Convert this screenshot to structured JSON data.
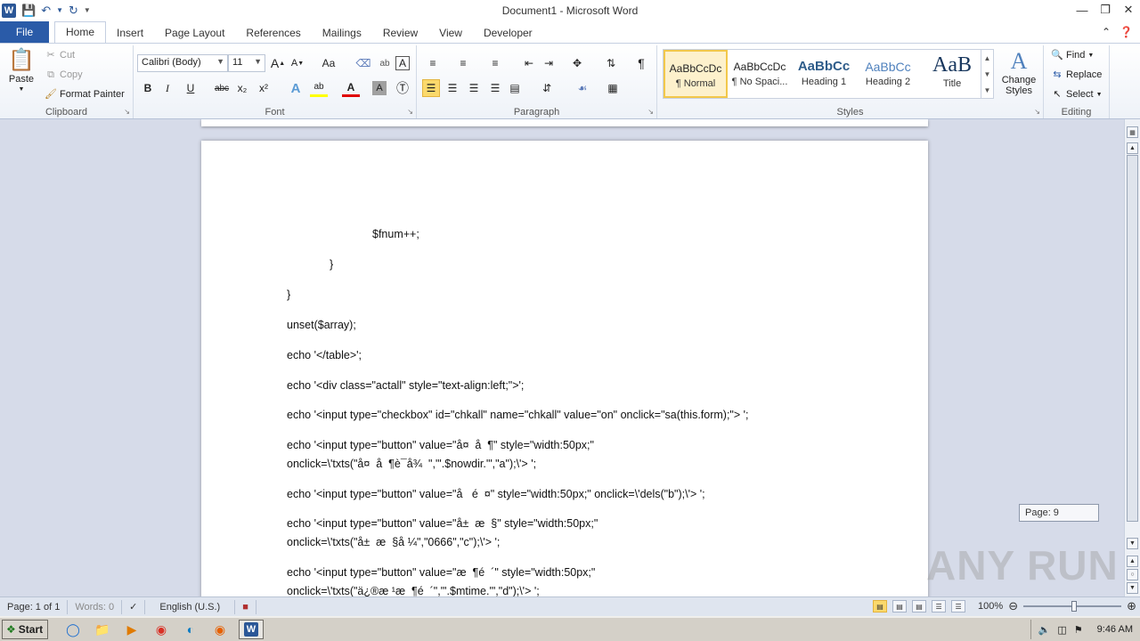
{
  "window": {
    "title": "Document1 - Microsoft Word",
    "controls": [
      "minimize",
      "restore",
      "close"
    ]
  },
  "qat": {
    "app_icon": "W",
    "save_icon": "save-icon",
    "undo_icon": "undo-icon",
    "redo_icon": "redo-icon"
  },
  "tabs": [
    {
      "label": "File"
    },
    {
      "label": "Home"
    },
    {
      "label": "Insert"
    },
    {
      "label": "Page Layout"
    },
    {
      "label": "References"
    },
    {
      "label": "Mailings"
    },
    {
      "label": "Review"
    },
    {
      "label": "View"
    },
    {
      "label": "Developer"
    }
  ],
  "active_tab": "Home",
  "ribbon": {
    "clipboard": {
      "label": "Clipboard",
      "paste": "Paste",
      "cut": "Cut",
      "copy": "Copy",
      "format_painter": "Format Painter"
    },
    "font": {
      "label": "Font",
      "font_name": "Calibri (Body)",
      "font_size": "11",
      "bold": "B",
      "italic": "I",
      "underline": "U",
      "strike": "abc",
      "subscript": "x₂",
      "superscript": "x²",
      "change_case": "Aa",
      "grow": "A",
      "shrink": "A"
    },
    "paragraph": {
      "label": "Paragraph",
      "pilcrow": "¶"
    },
    "styles": {
      "label": "Styles",
      "items": [
        {
          "preview": "AaBbCcDc",
          "name": "¶ Normal"
        },
        {
          "preview": "AaBbCcDc",
          "name": "¶ No Spaci..."
        },
        {
          "preview": "AaBbCc",
          "name": "Heading 1"
        },
        {
          "preview": "AaBbCc",
          "name": "Heading 2"
        },
        {
          "preview": "AaB",
          "name": "Title"
        }
      ],
      "change_styles": "Change Styles"
    },
    "editing": {
      "label": "Editing",
      "find": "Find",
      "replace": "Replace",
      "select": "Select"
    }
  },
  "document": {
    "lines": [
      "$fnum++;",
      "}",
      "}",
      "unset($array);",
      "echo '</table>';",
      "echo '<div class=\"actall\" style=\"text-align:left;\">';",
      "echo '<input type=\"checkbox\" id=\"chkall\" name=\"chkall\" value=\"on\" onclick=\"sa(this.form);\"> ';",
      "echo '<input type=\"button\" value=\"å¤  å  ¶\" style=\"width:50px;\"",
      "onclick=\\'txts(\"å¤  å  ¶è¯å¾  \",\"'.$nowdir.'\",\"a\");\\'> ';",
      "echo '<input type=\"button\" value=\"å   é  ¤\" style=\"width:50px;\" onclick=\\'dels(\"b\");\\'> ';",
      "echo '<input type=\"button\" value=\"å±  æ  §\" style=\"width:50px;\"",
      "onclick=\\'txts(\"å±  æ  §å ¼\",\"0666\",\"c\");\\'> ';",
      "echo '<input type=\"button\" value=\"æ  ¶é  ´\" style=\"width:50px;\"",
      "onclick=\\'txts(\"ä¿®æ ¹æ  ¶é  ´\",\"'.$mtime.'\",\"d\");\\'> ';"
    ]
  },
  "page_tooltip": "Page: 9",
  "watermark": "ANY RUN",
  "statusbar": {
    "page": "Page: 1 of 1",
    "words": "Words: 0",
    "language": "English (U.S.)",
    "zoom": "100%"
  },
  "taskbar": {
    "start": "Start",
    "time": "9:46 AM"
  }
}
